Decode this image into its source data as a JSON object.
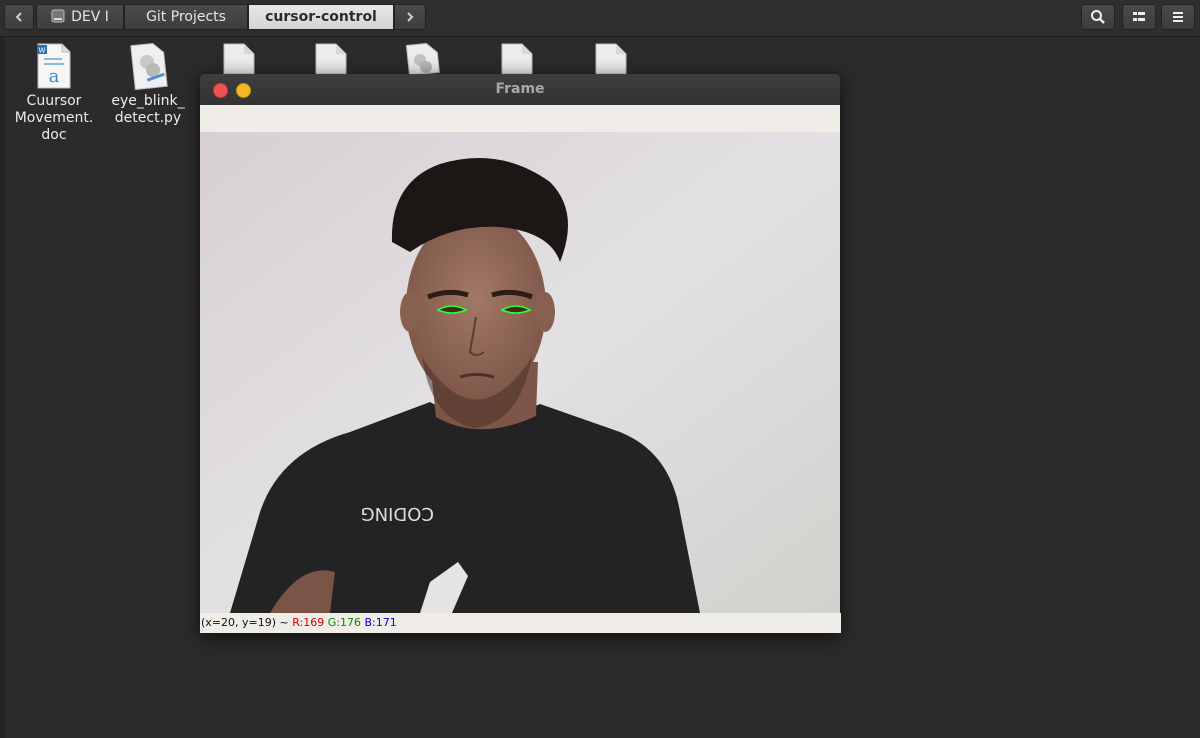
{
  "pathbar": {
    "crumbs": [
      "DEV I",
      "Git Projects",
      "cursor-control"
    ],
    "active_index": 2
  },
  "toolbar": {
    "icons": [
      "search-icon",
      "view-toggle-icon",
      "hamburger-menu-icon"
    ]
  },
  "desktop": {
    "files": [
      {
        "name": "Cuursor Movement. doc",
        "lines": [
          "Cuursor",
          "Movement.",
          "doc"
        ],
        "icon": "word-document-icon"
      },
      {
        "name": "eye_blink_ detect.py",
        "lines": [
          "eye_blink_",
          "detect.py"
        ],
        "icon": "python-file-icon"
      }
    ]
  },
  "frame_window": {
    "title": "Frame",
    "status": {
      "coords": "(x=20, y=19) ~ ",
      "r": "R:169",
      "g": "G:176",
      "b": "B:171"
    }
  },
  "colors": {
    "background": "#2b2b2b",
    "close": "#ef5350",
    "minimize": "#f4b724",
    "eye_contour": "#33ff33"
  }
}
